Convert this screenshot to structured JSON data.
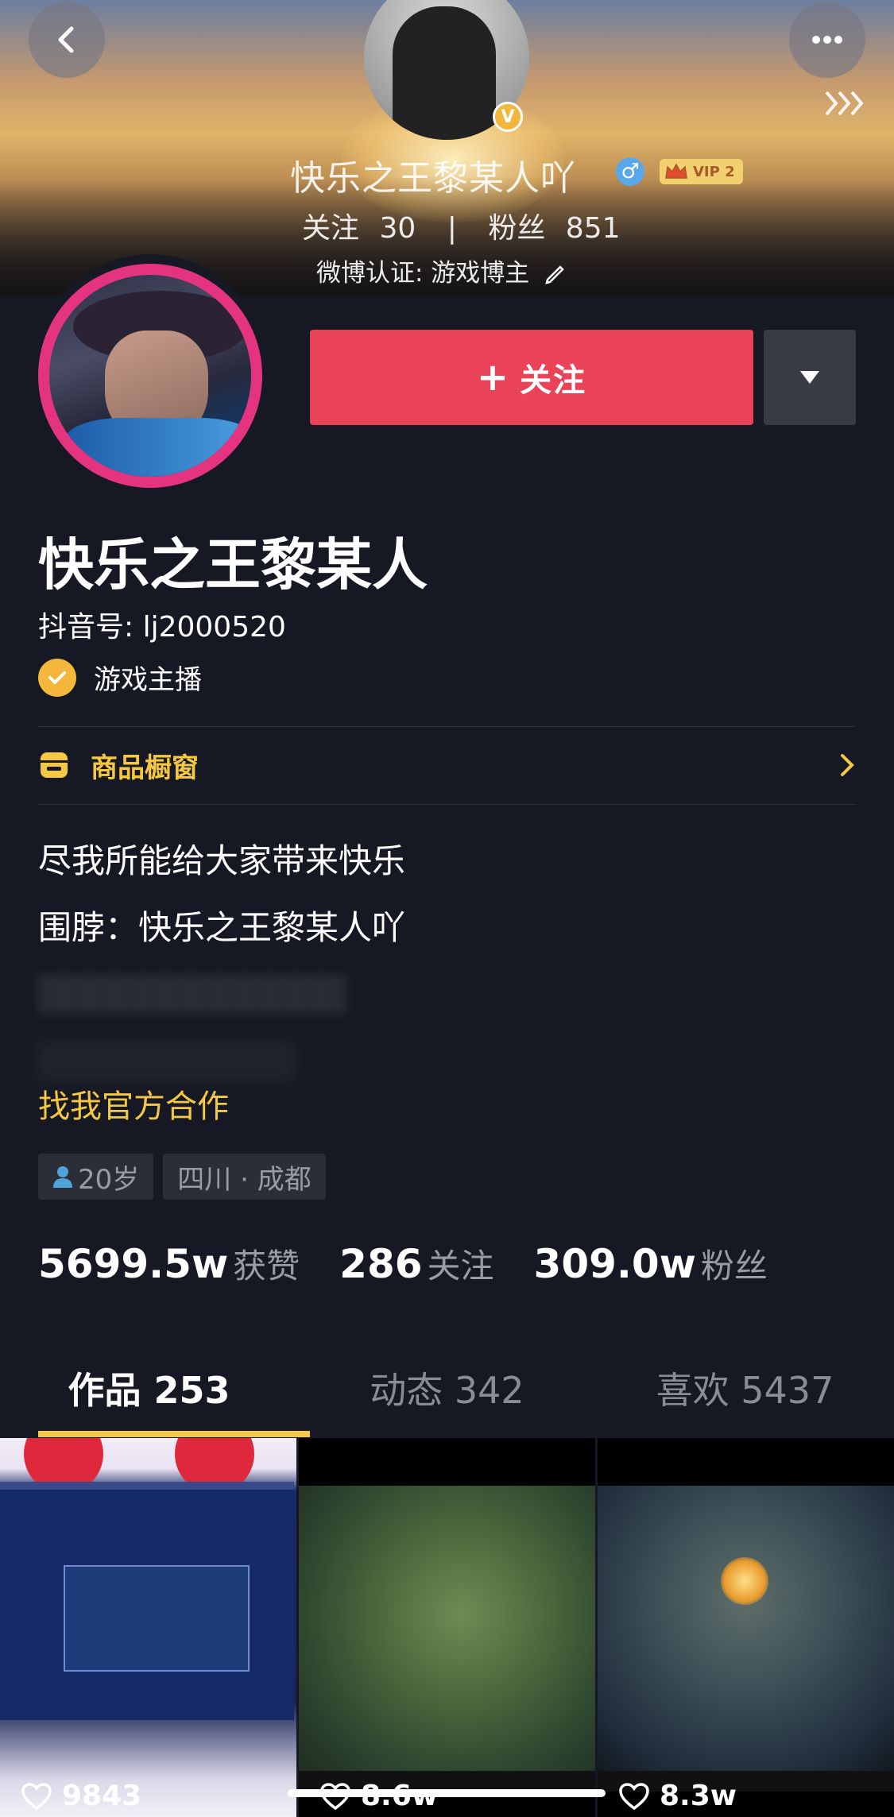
{
  "weibo_header": {
    "name": "快乐之王黎某人吖",
    "vip_label": "VIP 2",
    "following_label": "关注",
    "following_count": "30",
    "separator": "|",
    "fans_label": "粉丝",
    "fans_count": "851",
    "verify_text": "微博认证: 游戏博主"
  },
  "profile": {
    "follow_button_label": "关注",
    "nickname": "快乐之王黎某人",
    "douyin_id": "抖音号: lj2000520",
    "verify_label": "游戏主播",
    "shop_label": "商品橱窗",
    "bio_lines": [
      "尽我所能给大家带来快乐",
      "围脖：快乐之王黎某人吖"
    ],
    "coop_link": "找我官方合作",
    "tags": [
      "20岁",
      "四川 · 成都"
    ]
  },
  "stats": [
    {
      "value": "5699.5w",
      "label": "获赞"
    },
    {
      "value": "286",
      "label": "关注"
    },
    {
      "value": "309.0w",
      "label": "粉丝"
    }
  ],
  "tabs": [
    {
      "label": "作品 253",
      "active": true
    },
    {
      "label": "动态 342",
      "active": false
    },
    {
      "label": "喜欢 5437",
      "active": false
    }
  ],
  "videos": [
    {
      "likes": "9843"
    },
    {
      "likes": "8.6w"
    },
    {
      "likes": "8.3w"
    }
  ],
  "colors": {
    "background": "#161823",
    "follow_button": "#ea4359",
    "accent_yellow": "#f4c843",
    "avatar_ring": "#e5347f"
  },
  "icons": [
    "back-icon",
    "more-icon",
    "expand-icon",
    "verified-v-icon",
    "male-icon",
    "crown-icon",
    "pencil-icon",
    "plus-icon",
    "dropdown-triangle-icon",
    "check-icon",
    "shop-icon",
    "chevron-right-icon",
    "person-icon",
    "heart-icon"
  ]
}
